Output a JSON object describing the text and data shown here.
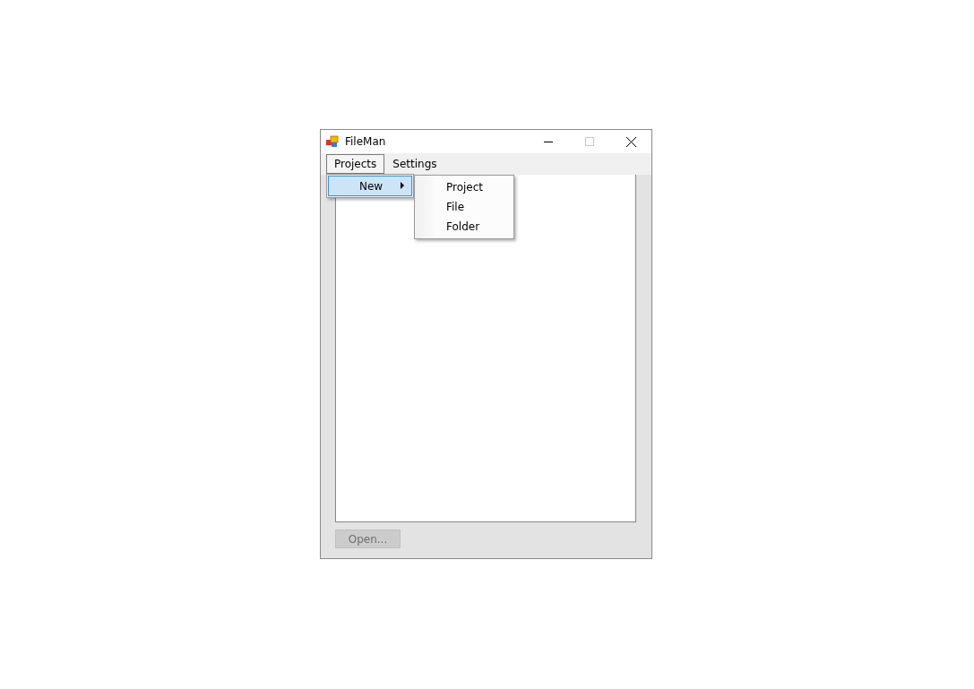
{
  "window": {
    "title": "FileMan"
  },
  "menu_bar": [
    {
      "label": "Projects",
      "open": true,
      "items": [
        {
          "label": "New",
          "selected": true,
          "children": [
            {
              "label": "Project"
            },
            {
              "label": "File"
            },
            {
              "label": "Folder"
            }
          ]
        }
      ]
    },
    {
      "label": "Settings",
      "open": false
    }
  ],
  "open_button": {
    "label": "Open...",
    "disabled": true
  }
}
